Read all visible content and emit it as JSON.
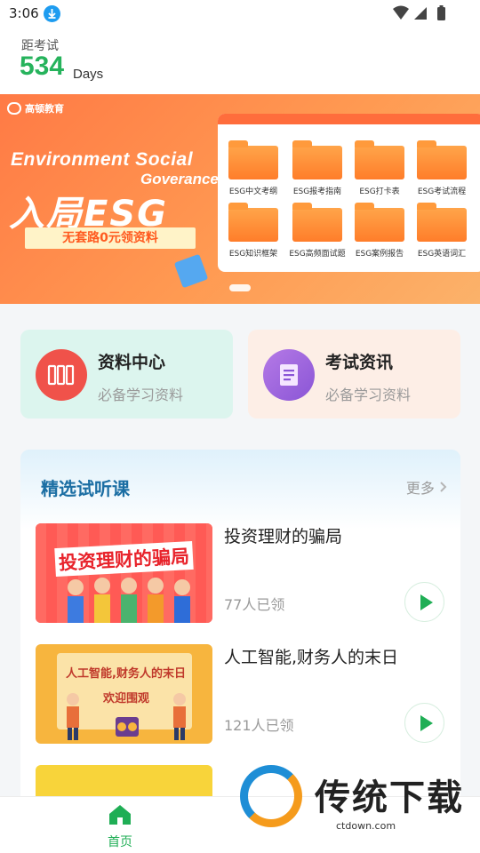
{
  "status_bar": {
    "time": "3:06"
  },
  "countdown": {
    "label": "距考试",
    "days": "534",
    "unit": "Days"
  },
  "banner": {
    "brand": "高顿教育",
    "headline_en_1": "Environment Social",
    "headline_en_2": "Goverance",
    "headline_big": "入局ESG",
    "tagline": "无套路0元领资料",
    "folders": [
      "ESG中文考纲",
      "ESG报考指南",
      "ESG打卡表",
      "ESG考试流程",
      "ESG知识框架",
      "ESG高频面试题",
      "ESG案例报告",
      "ESG英语词汇"
    ]
  },
  "quick_cards": [
    {
      "title": "资料中心",
      "subtitle": "必备学习资料",
      "icon": "book-icon",
      "color": "#f0524a"
    },
    {
      "title": "考试资讯",
      "subtitle": "必备学习资料",
      "icon": "document-icon",
      "color": "#9b64d8"
    }
  ],
  "courses": {
    "title": "精选试听课",
    "more": "更多",
    "items": [
      {
        "title": "投资理财的骗局",
        "count": "77人已领",
        "thumb_text": "投资理财的骗局",
        "thumb_bg": "#ff5a55"
      },
      {
        "title": "人工智能,财务人的末日",
        "count": "121人已领",
        "thumb_text": "人工智能,财务人的末日",
        "thumb_sub": "欢迎围观",
        "thumb_bg": "#f7b53e"
      },
      {
        "title": "",
        "count": "",
        "thumb_text": "",
        "thumb_bg": "#f8d43a"
      }
    ]
  },
  "tabbar": {
    "home_label": "首页"
  },
  "watermark": {
    "text": "传统下载",
    "url": "ctdown.com"
  },
  "colors": {
    "accent": "#1fae55",
    "countdown": "#26b35c",
    "banner": "#ff7a45"
  }
}
